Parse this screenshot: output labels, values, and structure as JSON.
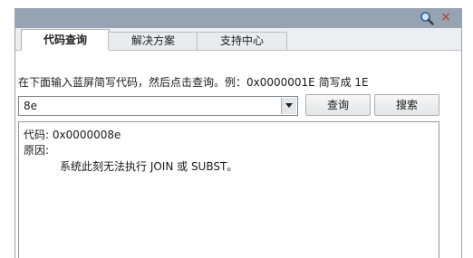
{
  "titlebar": {
    "search_icon": "magnifier-icon",
    "close_icon": "close-icon",
    "close_glyph": "×"
  },
  "tabs": [
    {
      "label": "代码查询",
      "active": true
    },
    {
      "label": "解决方案",
      "active": false
    },
    {
      "label": "支持中心",
      "active": false
    }
  ],
  "instruction": "在下面输入蓝屏简写代码，然后点击查询。例：0x0000001E 简写成 1E",
  "code_input": {
    "value": "8e"
  },
  "buttons": {
    "query": "查询",
    "search": "搜索"
  },
  "result": {
    "code_line": "代码: 0x0000008e",
    "reason_label": "原因:",
    "reason_text": "系统此刻无法执行 JOIN 或 SUBST。"
  },
  "colors": {
    "titlebar": "#97a3b0",
    "close": "#c0392b"
  }
}
